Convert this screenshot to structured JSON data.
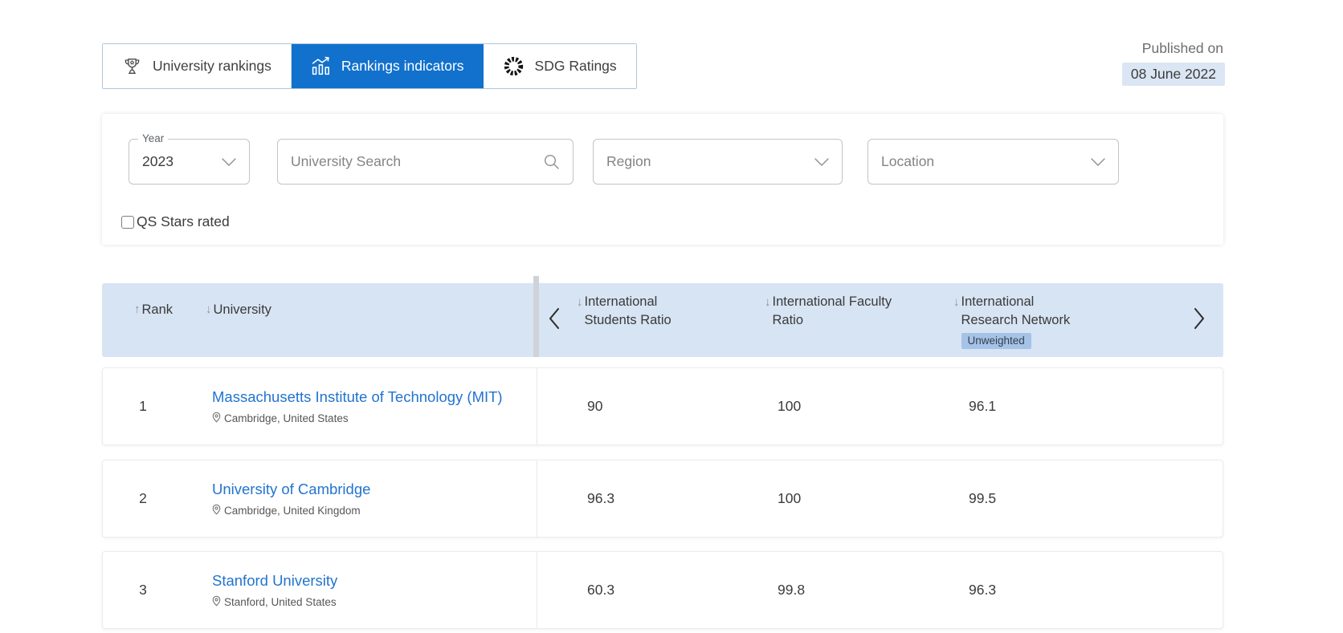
{
  "colors": {
    "accent_blue": "#1171cd",
    "header_bg": "#d7e4f3",
    "badge_bg": "#a5c3e6",
    "date_badge_bg": "#dbe6f4",
    "link_blue": "#2274cf"
  },
  "icons": {
    "sort_asc": "↑",
    "sort_desc": "↓"
  },
  "published": {
    "label": "Published on",
    "date": "08 June 2022"
  },
  "tabs": [
    {
      "label": "University rankings",
      "icon": "trophy-icon",
      "active": false
    },
    {
      "label": "Rankings indicators",
      "icon": "chart-icon",
      "active": true
    },
    {
      "label": "SDG Ratings",
      "icon": "sdg-ring-icon",
      "active": false
    }
  ],
  "filters": {
    "year": {
      "label": "Year",
      "value": "2023"
    },
    "search_placeholder": "University Search",
    "region_placeholder": "Region",
    "location_placeholder": "Location",
    "qs_stars_label": "QS Stars rated",
    "qs_stars_checked": false
  },
  "table": {
    "fixed_columns": [
      {
        "label": "Rank",
        "sort": "asc"
      },
      {
        "label": "University",
        "sort": "desc"
      }
    ],
    "scroll_columns": [
      {
        "label": "International Students Ratio",
        "sort": "desc"
      },
      {
        "label": "International Faculty Ratio",
        "sort": "desc"
      },
      {
        "label": "International Research Network",
        "sort": "desc",
        "badge": "Unweighted"
      }
    ],
    "rows": [
      {
        "rank": "1",
        "university": "Massachusetts Institute of Technology (MIT)",
        "location": "Cambridge, United States",
        "values": [
          "90",
          "100",
          "96.1"
        ]
      },
      {
        "rank": "2",
        "university": "University of Cambridge",
        "location": "Cambridge, United Kingdom",
        "values": [
          "96.3",
          "100",
          "99.5"
        ]
      },
      {
        "rank": "3",
        "university": "Stanford University",
        "location": "Stanford, United States",
        "values": [
          "60.3",
          "99.8",
          "96.3"
        ]
      }
    ]
  }
}
